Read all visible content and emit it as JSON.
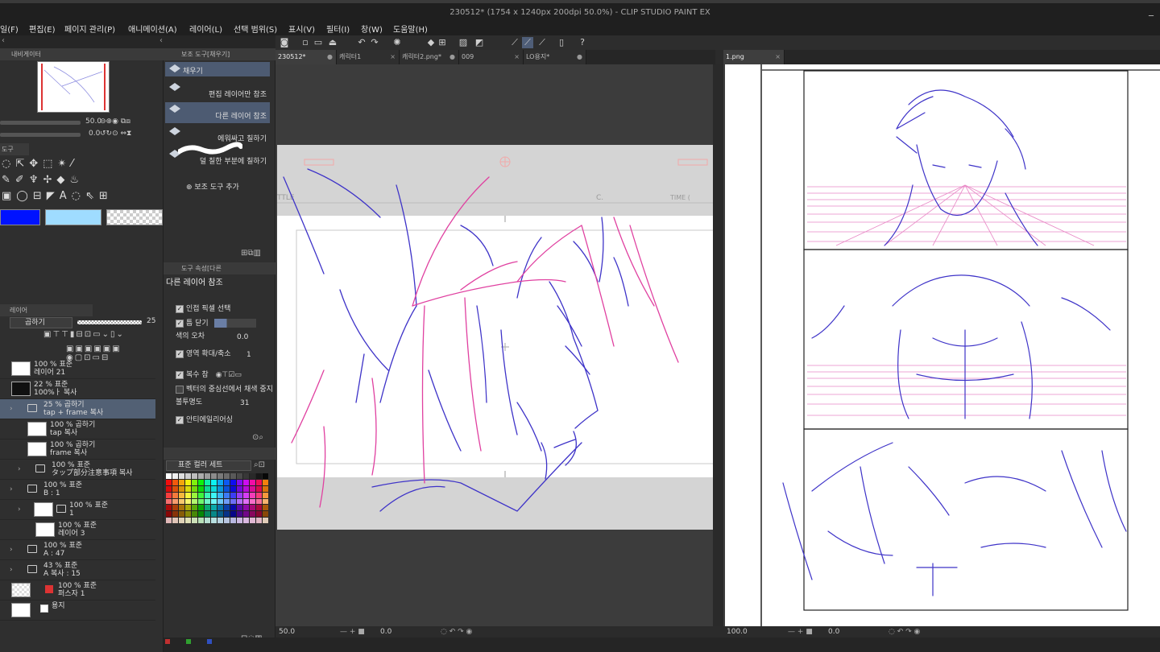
{
  "window": {
    "title": "230512* (1754 x 1240px 200dpi 50.0%) - CLIP STUDIO PAINT EX",
    "minimize_symbol": "_"
  },
  "menu": [
    "일(F)",
    "편집(E)",
    "페이지 관리(P)",
    "애니메이션(A)",
    "레이어(L)",
    "선택 범위(S)",
    "표시(V)",
    "필터(I)",
    "창(W)",
    "도움말(H)"
  ],
  "navigator": {
    "tab_label": "내비게이터",
    "zoom": "50.0",
    "rotation": "0.0"
  },
  "tool": {
    "tab_label": "도구"
  },
  "colors": {
    "main": "#0012ff",
    "sub": "#9fdcff",
    "transparent": "checker"
  },
  "layer_panel": {
    "tab_label": "레이어",
    "blend_mode": "곱하기",
    "opacity": "25",
    "layers": [
      {
        "line1": "100 % 표준",
        "line2": "레이어 21",
        "indent": 0,
        "kind": "thumb"
      },
      {
        "line1": "22 % 표준",
        "line2": "100%ㅏ 복사",
        "indent": 0,
        "kind": "thumb"
      },
      {
        "line1": "25 % 곱하기",
        "line2": "tap + frame 복사",
        "indent": 1,
        "kind": "folder",
        "selected": true
      },
      {
        "line1": "100 % 곱하기",
        "line2": "tap 복사",
        "indent": 2,
        "kind": "thumb"
      },
      {
        "line1": "100 % 곱하기",
        "line2": "frame 복사",
        "indent": 2,
        "kind": "thumb"
      },
      {
        "line1": "100 % 표준",
        "line2": "タップ部分注意事項 복사",
        "indent": 2,
        "kind": "folder"
      },
      {
        "line1": "100 % 표준",
        "line2": "B : 1",
        "indent": 1,
        "kind": "folder"
      },
      {
        "line1": "100 % 표준",
        "line2": "1",
        "indent": 2,
        "kind": "folder-thumb"
      },
      {
        "line1": "100 % 표준",
        "line2": "레이어 3",
        "indent": 3,
        "kind": "thumb"
      },
      {
        "line1": "100 % 표준",
        "line2": "A : 47",
        "indent": 1,
        "kind": "folder"
      },
      {
        "line1": "43 % 표준",
        "line2": "A 복사 : 15",
        "indent": 1,
        "kind": "folder"
      },
      {
        "line1": "100 % 표준",
        "line2": "퍼스자 1",
        "indent": 0,
        "kind": "ruler"
      },
      {
        "line1": "",
        "line2": "용지",
        "indent": 0,
        "kind": "paper"
      }
    ]
  },
  "subtool": {
    "tab_label": "보조 도구[채우기]",
    "group_label": "채우기",
    "items": [
      {
        "label": "편집 레이어만 참조",
        "selected": false
      },
      {
        "label": "다른 레이어 참조",
        "selected": true
      },
      {
        "label": "에워싸고 칠하기",
        "selected": false
      },
      {
        "label": "덜 칠한 부분에 칠하기",
        "selected": false
      }
    ],
    "add_label": "보조 도구 추가"
  },
  "tool_property": {
    "tab_label": "도구 속성[다른",
    "title": "다른 레이어 참조",
    "rows": [
      {
        "label": "인접 픽셀 선택",
        "checked": true
      },
      {
        "label": "틈 닫기",
        "checked": true
      },
      {
        "label": "색의 오차",
        "value": "0.0"
      },
      {
        "label": "영역 확대/축소",
        "value": "1",
        "checked": true
      },
      {
        "label": "복수 참",
        "checked": true
      },
      {
        "label": "벡터의 중심선에서 채색 중지",
        "checked": false
      },
      {
        "label": "불투명도",
        "value": "31"
      },
      {
        "label": "안티에일리어싱",
        "checked": true
      }
    ]
  },
  "color_set": {
    "selected": "표준 컬러 세트"
  },
  "tabs_left": [
    {
      "label": "230512*",
      "active": true,
      "close": "●"
    },
    {
      "label": "캐릭터1",
      "active": false,
      "close": "×"
    },
    {
      "label": "캐릭터2.png*",
      "active": false,
      "close": "●"
    },
    {
      "label": "009",
      "active": false,
      "close": "×"
    },
    {
      "label": "LO용지*",
      "active": false,
      "close": "●"
    }
  ],
  "tabs_right": [
    {
      "label": "1.png",
      "active": true,
      "close": "×"
    }
  ],
  "canvas_left": {
    "frame_label_title": "TTLE",
    "frame_label_c": "C.",
    "frame_label_time": "TIME (",
    "zoom": "50.0",
    "angle": "0.0"
  },
  "canvas_right": {
    "zoom": "100.0",
    "angle": "0.0"
  },
  "sketch_colors": {
    "blue": "#3e33c8",
    "pink": "#e040a0"
  }
}
